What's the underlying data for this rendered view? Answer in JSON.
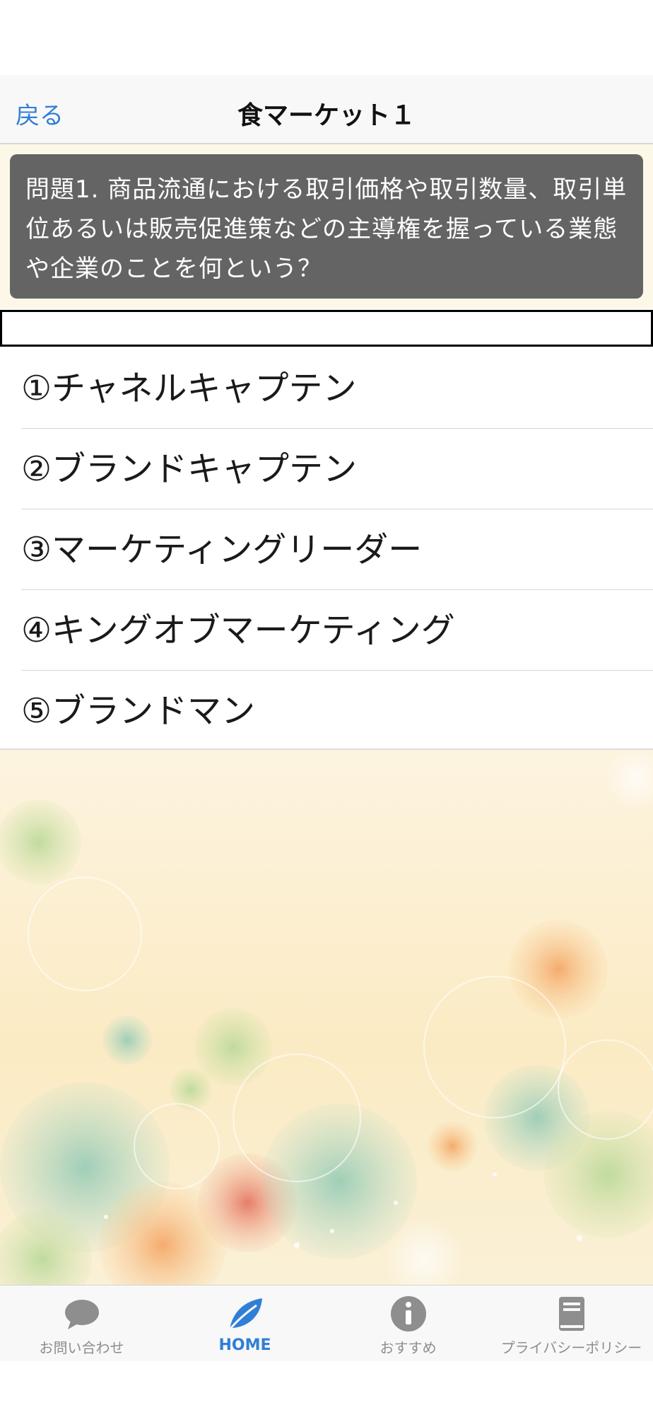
{
  "nav": {
    "back_label": "戻る",
    "title": "食マーケット１"
  },
  "question": {
    "text": "問題1. 商品流通における取引価格や取引数量、取引単位あるいは販売促進策などの主導権を握っている業態や企業のことを何という？"
  },
  "answer_input": {
    "value": ""
  },
  "choices": [
    {
      "label": "①チャネルキャプテン"
    },
    {
      "label": "②ブランドキャプテン"
    },
    {
      "label": "③マーケティングリーダー"
    },
    {
      "label": "④キングオブマーケティング"
    },
    {
      "label": "⑤ブランドマン"
    }
  ],
  "tabbar": {
    "tabs": [
      {
        "label": "お問い合わせ",
        "icon": "speech-bubble-icon",
        "active": false
      },
      {
        "label": "HOME",
        "icon": "leaf-icon",
        "active": true
      },
      {
        "label": "おすすめ",
        "icon": "info-icon",
        "active": false
      },
      {
        "label": "プライバシーポリシー",
        "icon": "book-icon",
        "active": false
      }
    ]
  },
  "colors": {
    "accent": "#2f7fd6",
    "question_bg": "#646464",
    "tab_inactive": "#8e8e8e",
    "background_art": "#fbebc4"
  }
}
